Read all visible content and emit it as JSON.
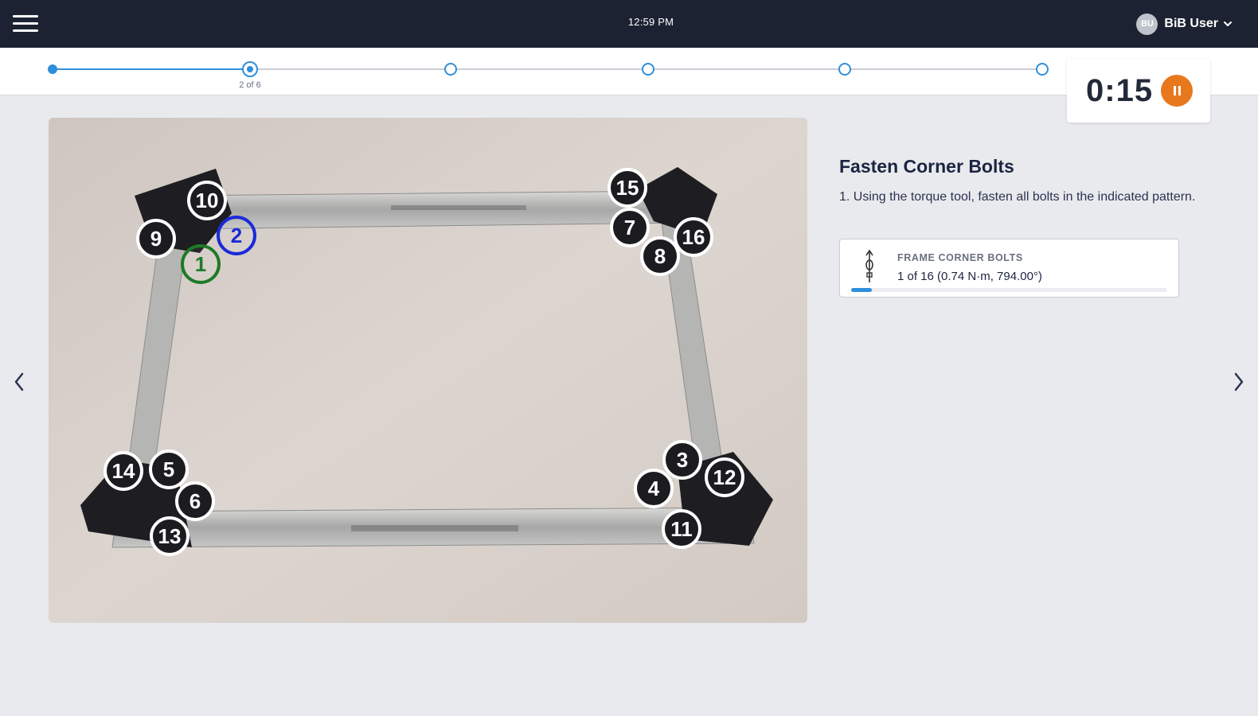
{
  "header": {
    "time": "12:59 PM",
    "user_initials": "BU",
    "user_name": "BiB User",
    "menu_icon": "hamburger-menu-icon",
    "dropdown_icon": "chevron-down-icon"
  },
  "stepper": {
    "total_steps": 6,
    "current_step": 2,
    "current_label": "2 of 6",
    "accent_color": "#2f8fdb"
  },
  "timer": {
    "value": "0:15",
    "button_icon": "pause-icon",
    "button_color": "#e8781d"
  },
  "photo": {
    "description_icon": "frame-assembly-photo",
    "bolt_markers": [
      {
        "number": "1",
        "state": "done",
        "color": "#1e7a28"
      },
      {
        "number": "2",
        "state": "current",
        "color": "#1a2bd9"
      },
      {
        "number": "3",
        "state": "pending"
      },
      {
        "number": "4",
        "state": "pending"
      },
      {
        "number": "5",
        "state": "pending"
      },
      {
        "number": "6",
        "state": "pending"
      },
      {
        "number": "7",
        "state": "pending"
      },
      {
        "number": "8",
        "state": "pending"
      },
      {
        "number": "9",
        "state": "pending"
      },
      {
        "number": "10",
        "state": "pending"
      },
      {
        "number": "11",
        "state": "pending"
      },
      {
        "number": "12",
        "state": "pending"
      },
      {
        "number": "13",
        "state": "pending"
      },
      {
        "number": "14",
        "state": "pending"
      },
      {
        "number": "15",
        "state": "pending"
      },
      {
        "number": "16",
        "state": "pending"
      }
    ]
  },
  "navigation": {
    "prev_icon": "chevron-left-icon",
    "next_icon": "chevron-right-icon"
  },
  "step": {
    "title": "Fasten Corner Bolts",
    "instruction": "1. Using the torque tool, fasten all bolts in the indicated pattern."
  },
  "tool": {
    "icon": "torque-wrench-icon",
    "name": "FRAME CORNER BOLTS",
    "progress_text": "1 of 16 (0.74 N·m, 794.00°)",
    "completed": 1,
    "total": 16
  }
}
